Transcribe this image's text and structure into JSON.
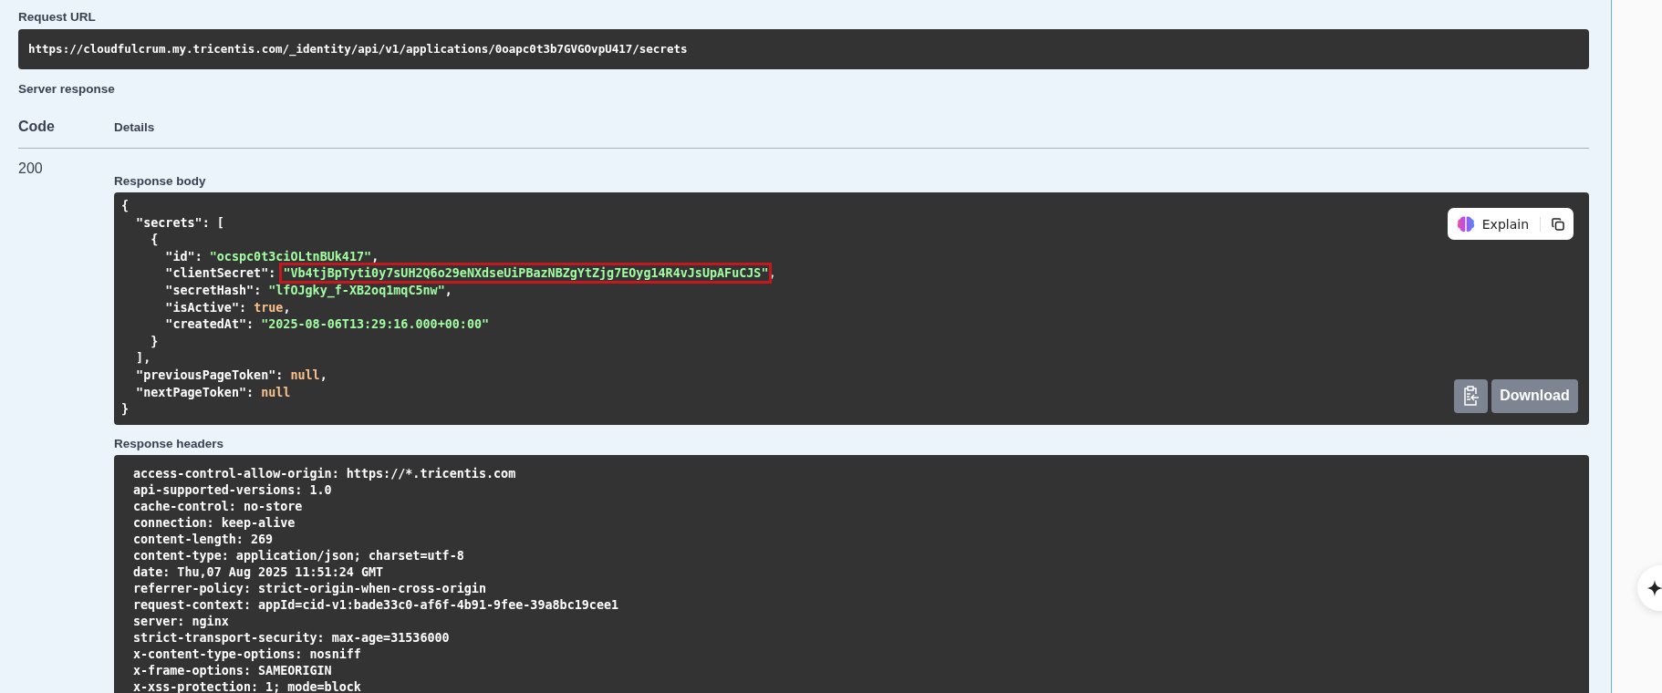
{
  "request_url": {
    "label": "Request URL",
    "value": "https://cloudfulcrum.my.tricentis.com/_identity/api/v1/applications/0oapc0t3b7GVGOvpU417/secrets"
  },
  "server_response": {
    "label": "Server response",
    "columns": [
      "Code",
      "Details"
    ],
    "rows": [
      {
        "code": "200",
        "response_body": {
          "label": "Response body",
          "lines": [
            {
              "highlight": false,
              "tokens": [
                {
                  "kind": "punct",
                  "text": "{"
                }
              ]
            },
            {
              "highlight": false,
              "tokens": [
                {
                  "kind": "key",
                  "text": "  \"secrets\""
                },
                {
                  "kind": "punct",
                  "text": ": ["
                }
              ]
            },
            {
              "highlight": false,
              "tokens": [
                {
                  "kind": "punct",
                  "text": "    {"
                }
              ]
            },
            {
              "highlight": false,
              "tokens": [
                {
                  "kind": "key",
                  "text": "      \"id\""
                },
                {
                  "kind": "punct",
                  "text": ": "
                },
                {
                  "kind": "string",
                  "text": "\"ocspc0t3ciOLtnBUk417\""
                },
                {
                  "kind": "punct",
                  "text": ","
                }
              ]
            },
            {
              "highlight": true,
              "tokens": [
                {
                  "kind": "key",
                  "text": "      \"clientSecret\""
                },
                {
                  "kind": "punct",
                  "text": ": "
                },
                {
                  "kind": "string",
                  "text": "\"Vb4tjBpTyti0y7sUH2Q6o29eNXdseUiPBazNBZgYtZjg7EOyg14R4vJsUpAFuCJS\""
                },
                {
                  "kind": "punct",
                  "text": ","
                }
              ]
            },
            {
              "highlight": false,
              "tokens": [
                {
                  "kind": "key",
                  "text": "      \"secretHash\""
                },
                {
                  "kind": "punct",
                  "text": ": "
                },
                {
                  "kind": "string",
                  "text": "\"lfOJgky_f-XB2oq1mqC5nw\""
                },
                {
                  "kind": "punct",
                  "text": ","
                }
              ]
            },
            {
              "highlight": false,
              "tokens": [
                {
                  "kind": "key",
                  "text": "      \"isActive\""
                },
                {
                  "kind": "punct",
                  "text": ": "
                },
                {
                  "kind": "literal",
                  "text": "true"
                },
                {
                  "kind": "punct",
                  "text": ","
                }
              ]
            },
            {
              "highlight": false,
              "tokens": [
                {
                  "kind": "key",
                  "text": "      \"createdAt\""
                },
                {
                  "kind": "punct",
                  "text": ": "
                },
                {
                  "kind": "string",
                  "text": "\"2025-08-06T13:29:16.000+00:00\""
                }
              ]
            },
            {
              "highlight": false,
              "tokens": [
                {
                  "kind": "punct",
                  "text": "    }"
                }
              ]
            },
            {
              "highlight": false,
              "tokens": [
                {
                  "kind": "punct",
                  "text": "  ],"
                }
              ]
            },
            {
              "highlight": false,
              "tokens": [
                {
                  "kind": "key",
                  "text": "  \"previousPageToken\""
                },
                {
                  "kind": "punct",
                  "text": ": "
                },
                {
                  "kind": "literal",
                  "text": "null"
                },
                {
                  "kind": "punct",
                  "text": ","
                }
              ]
            },
            {
              "highlight": false,
              "tokens": [
                {
                  "kind": "key",
                  "text": "  \"nextPageToken\""
                },
                {
                  "kind": "punct",
                  "text": ": "
                },
                {
                  "kind": "literal",
                  "text": "null"
                }
              ]
            },
            {
              "highlight": false,
              "tokens": [
                {
                  "kind": "punct",
                  "text": "}"
                }
              ]
            }
          ],
          "explain_button": "Explain",
          "download_button": "Download"
        },
        "response_headers": {
          "label": "Response headers",
          "lines": [
            "access-control-allow-origin: https://*.tricentis.com",
            "api-supported-versions: 1.0",
            "cache-control: no-store",
            "connection: keep-alive",
            "content-length: 269",
            "content-type: application/json; charset=utf-8",
            "date: Thu,07 Aug 2025 11:51:24 GMT",
            "referrer-policy: strict-origin-when-cross-origin",
            "request-context: appId=cid-v1:bade33c0-af6f-4b91-9fee-39a8bc19cee1",
            "server: nginx",
            "strict-transport-security: max-age=31536000",
            "x-content-type-options: nosniff",
            "x-frame-options: SAMEORIGIN",
            "x-xss-protection: 1; mode=block"
          ]
        }
      }
    ]
  }
}
